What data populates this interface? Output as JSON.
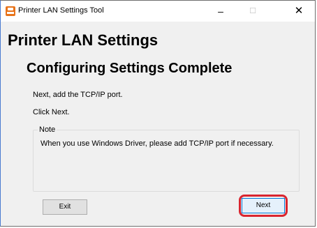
{
  "window": {
    "title": "Printer LAN Settings Tool",
    "icon": "printer-app-icon",
    "controls": {
      "minimize": "–",
      "maximize": "☐",
      "close": "✕"
    }
  },
  "page": {
    "heading": "Printer LAN Settings",
    "subheading": "Configuring Settings Complete",
    "instruction_1": "Next, add the TCP/IP port.",
    "instruction_2": "Click Next."
  },
  "note": {
    "title": "Note",
    "body": "When you use Windows Driver, please add TCP/IP port if necessary."
  },
  "buttons": {
    "exit": "Exit",
    "next": "Next"
  },
  "colors": {
    "highlight": "#d9252f",
    "accent": "#0078d7",
    "app_icon": "#e8731a"
  }
}
